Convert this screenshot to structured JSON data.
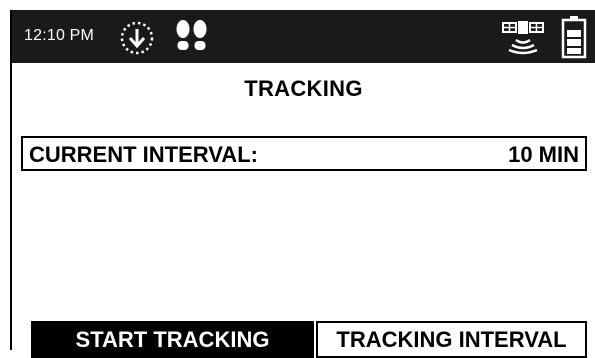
{
  "status_bar": {
    "time": "12:10 PM",
    "icons": [
      "download-icon",
      "footsteps-icon",
      "satellite-icon",
      "battery-icon"
    ],
    "background_color": "#1a1a1a"
  },
  "screen": {
    "title": "TRACKING",
    "current_interval": {
      "label": "CURRENT INTERVAL:",
      "value": "10 MIN"
    }
  },
  "buttons": {
    "start_tracking": "START TRACKING",
    "tracking_interval": "TRACKING INTERVAL"
  }
}
